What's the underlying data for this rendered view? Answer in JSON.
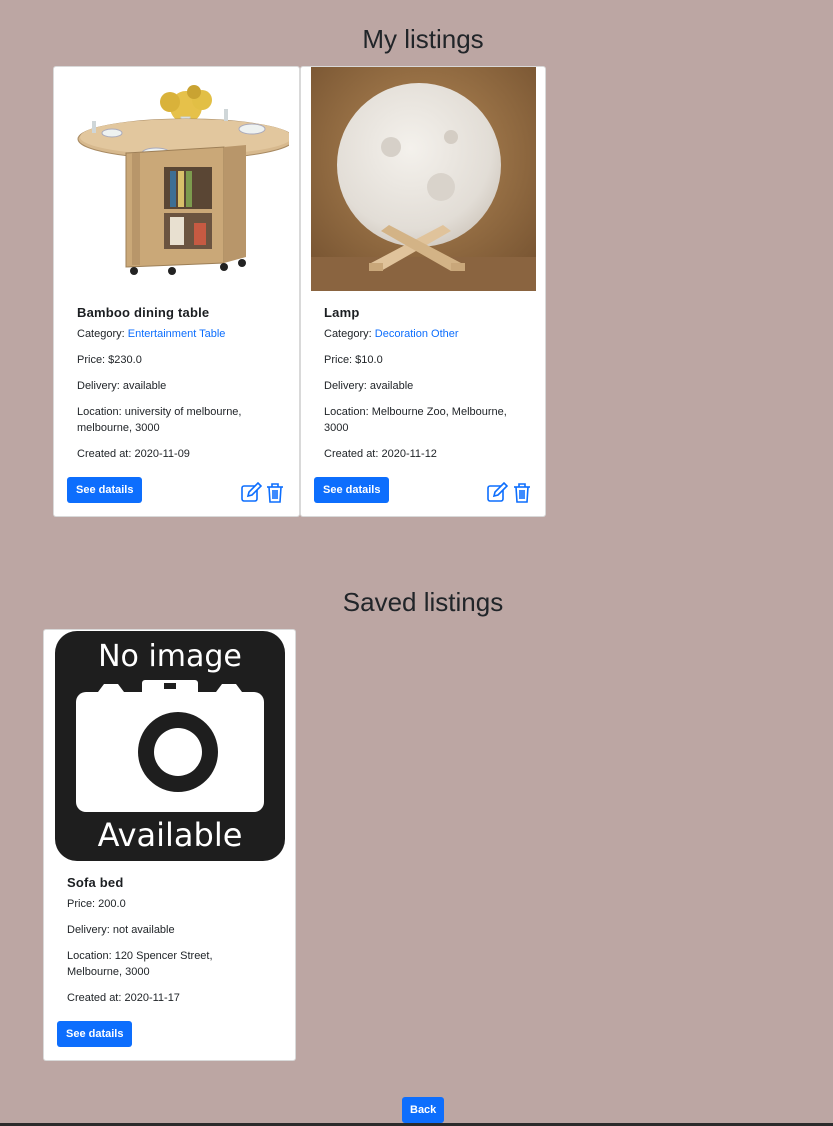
{
  "my_listings": {
    "title": "My listings",
    "items": [
      {
        "title": "Bamboo dining table",
        "category_label": "Category:",
        "category_value": "Entertainment Table",
        "price": "Price: $230.0",
        "delivery": "Delivery: available",
        "location_line1": "Location: university of melbourne,",
        "location_line2": "melbourne, 3000",
        "created": "Created at: 2020-11-09",
        "button": "See datails"
      },
      {
        "title": "Lamp",
        "category_label": "Category:",
        "category_value": "Decoration Other",
        "price": "Price: $10.0",
        "delivery": "Delivery: available",
        "location_line1": "Location: Melbourne Zoo, Melbourne,",
        "location_line2": "3000",
        "created": "Created at: 2020-11-12",
        "button": "See datails"
      }
    ]
  },
  "saved_listings": {
    "title": "Saved listings",
    "items": [
      {
        "placeholder_top": "No image",
        "placeholder_bottom": "Available",
        "title": "Sofa bed",
        "price": "Price: 200.0",
        "delivery": "Delivery: not available",
        "location_line1": "Location: 120 Spencer Street,",
        "location_line2": "Melbourne, 3000",
        "created": "Created at: 2020-11-17",
        "button": "See datails"
      }
    ]
  },
  "back_button": "Back",
  "icons": [
    "edit-icon",
    "trash-icon"
  ],
  "colors": {
    "background": "#bca6a3",
    "accent": "#0d6efd"
  }
}
